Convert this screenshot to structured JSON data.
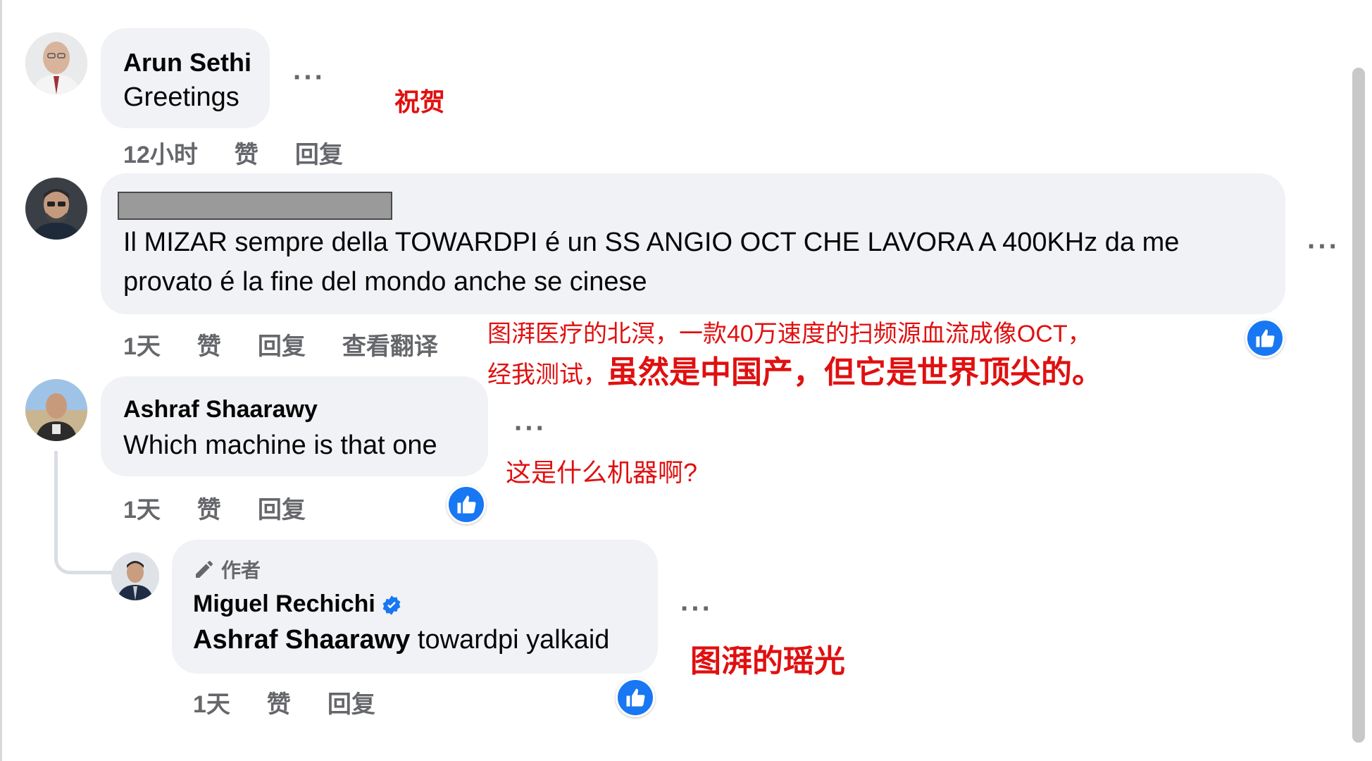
{
  "comments": [
    {
      "author": "Arun Sethi",
      "text": "Greetings",
      "time": "12小时",
      "like_label": "赞",
      "reply_label": "回复",
      "annotation": "祝贺"
    },
    {
      "author": "",
      "text_line1": "Il MIZAR sempre della TOWARDPI é un SS ANGIO OCT CHE LAVORA A 400KHz da me",
      "text_line2": "provato é la fine del mondo anche se cinese",
      "time": "1天",
      "like_label": "赞",
      "reply_label": "回复",
      "translate_label": "查看翻译",
      "annotation_line1": "图湃医疗的北溟，一款40万速度的扫频源血流成像OCT，",
      "annotation_line2_prefix": "经我测试，",
      "annotation_line2_bold": "虽然是中国产，但它是世界顶尖的。"
    },
    {
      "author": "Ashraf Shaarawy",
      "text": "Which machine is that one",
      "time": "1天",
      "like_label": "赞",
      "reply_label": "回复",
      "annotation": "这是什么机器啊?"
    },
    {
      "author_tag": "作者",
      "author": "Miguel Rechichi",
      "mention": "Ashraf Shaarawy",
      "text": " towardpi yalkaid",
      "time": "1天",
      "like_label": "赞",
      "reply_label": "回复",
      "annotation": "图湃的瑶光"
    }
  ],
  "more_glyph": "···",
  "colors": {
    "bubble_bg": "#f0f2f5",
    "like_blue": "#1877f2",
    "annotation_red": "#e01010",
    "secondary_text": "#65676b"
  },
  "icons": [
    "more-options-icon",
    "like-icon",
    "pencil-icon",
    "verified-badge-icon"
  ]
}
